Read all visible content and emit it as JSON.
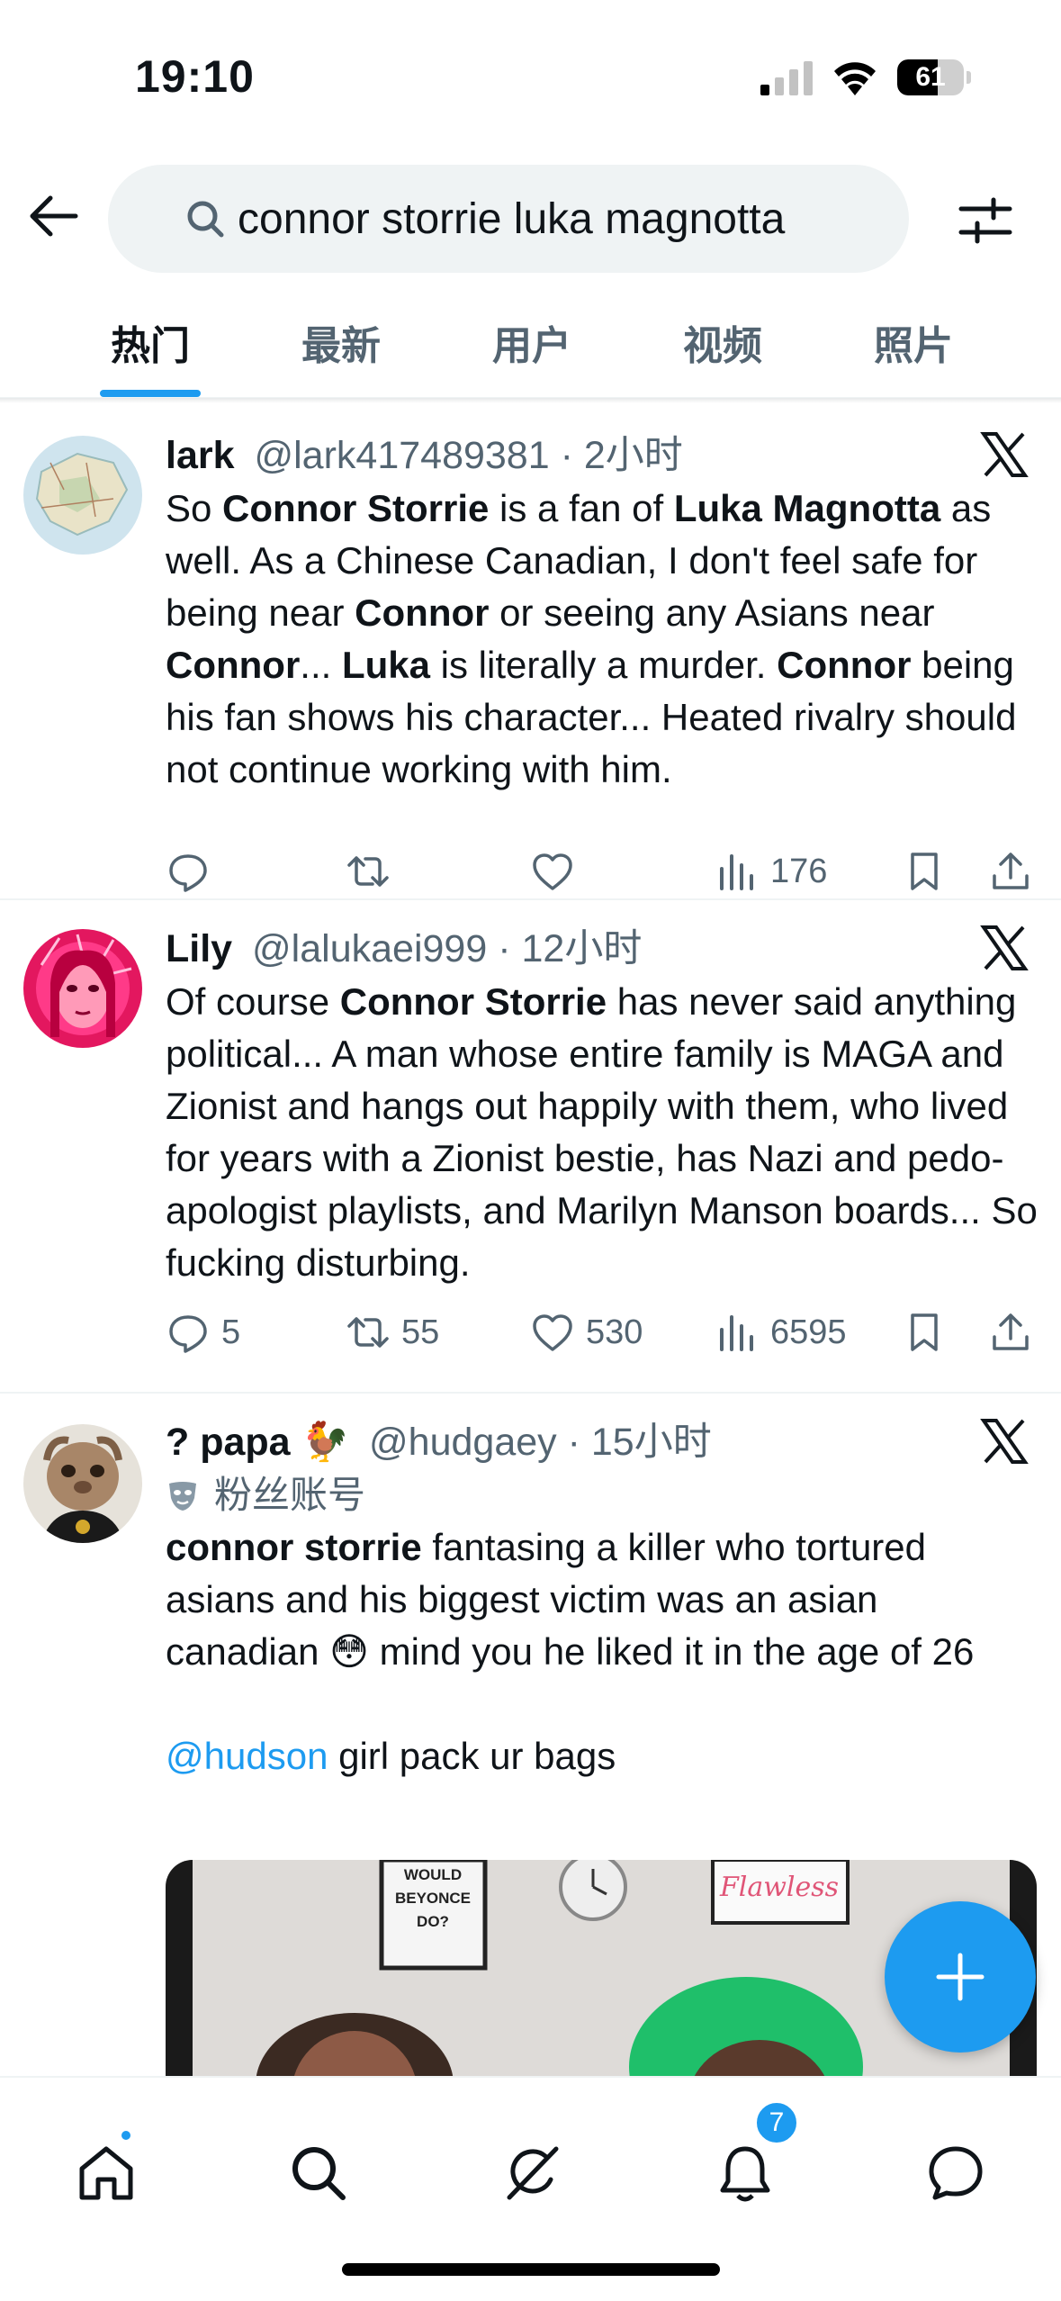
{
  "status_bar": {
    "time": "19:10",
    "battery": "61",
    "battery_level": 0.61
  },
  "search": {
    "query": "connor storrie luka magnotta",
    "icons": [
      "back-arrow-icon",
      "search-icon",
      "filter-icon"
    ]
  },
  "tabs": [
    "热门",
    "最新",
    "用户",
    "视频",
    "照片"
  ],
  "active_tab": "热门",
  "tweets": [
    {
      "name": "lark",
      "handle": "@lark417489381",
      "sep": "·",
      "time": "2小时",
      "segments": [
        {
          "t": "So "
        },
        {
          "t": "Connor Storrie",
          "b": true
        },
        {
          "t": " is a fan of "
        },
        {
          "t": "Luka Magnotta",
          "b": true
        },
        {
          "t": " as well. As a Chinese Canadian, I don't feel safe for being near "
        },
        {
          "t": "Connor",
          "b": true
        },
        {
          "t": " or seeing any Asians near "
        },
        {
          "t": "Connor",
          "b": true
        },
        {
          "t": "... "
        },
        {
          "t": "Luka",
          "b": true
        },
        {
          "t": " is literally a murder. "
        },
        {
          "t": "Connor",
          "b": true
        },
        {
          "t": " being his fan shows his character... Heated rivalry should not continue working with him."
        }
      ],
      "stats": {
        "replies": "",
        "retweets": "",
        "likes": "",
        "views": "176"
      }
    },
    {
      "name": "Lily",
      "handle": "@lalukaei999",
      "sep": "·",
      "time": "12小时",
      "segments": [
        {
          "t": "Of course "
        },
        {
          "t": "Connor Storrie",
          "b": true
        },
        {
          "t": " has never said anything political... A man whose entire family is MAGA and Zionist and hangs out happily with them, who lived for years with a Zionist bestie, has Nazi and pedo-apologist playlists, and Marilyn Manson boards... So fucking disturbing."
        }
      ],
      "stats": {
        "replies": "5",
        "retweets": "55",
        "likes": "530",
        "views": "6595"
      }
    },
    {
      "name": "? papa 🐓",
      "handle": "@hudgaey",
      "sep": "·",
      "time": "15小时",
      "badge": "粉丝账号",
      "segments": [
        {
          "t": "connor storrie",
          "b": true
        },
        {
          "t": " fantasing a killer who tortured asians and his biggest victim was an asian canadian 😳 mind you he liked it in the age of 26"
        }
      ],
      "mention": "@hudson",
      "mention_tail": " girl pack ur bags",
      "media_signs": [
        "WOULD BEYONCE DO?",
        "Flawless"
      ]
    }
  ],
  "bottom_nav": {
    "items": [
      "home-icon",
      "search-icon",
      "grok-icon",
      "bell-icon",
      "messages-icon"
    ],
    "notifications": "7"
  },
  "colors": {
    "accent": "#1d9bf0",
    "text": "#0f1419",
    "muted": "#536471",
    "divider": "#eff3f4"
  }
}
